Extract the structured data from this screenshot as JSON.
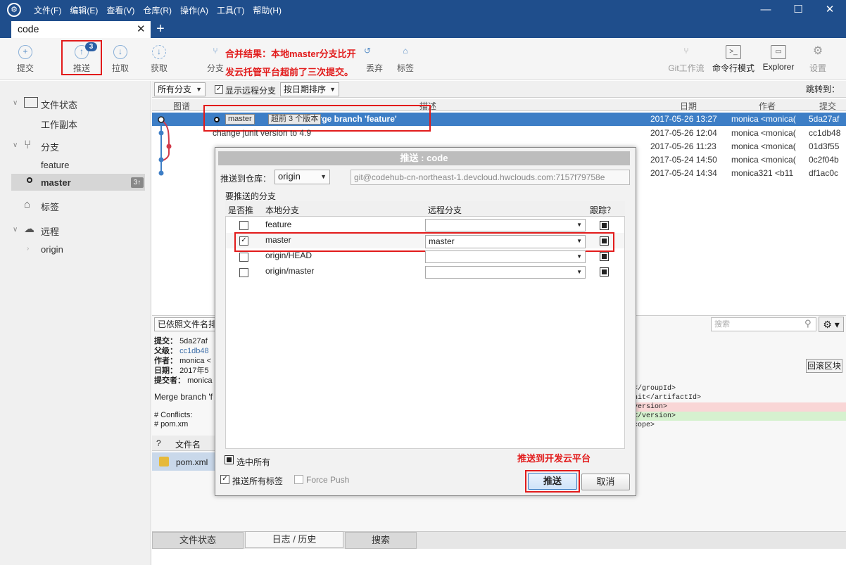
{
  "menu": [
    "文件(F)",
    "编辑(E)",
    "查看(V)",
    "仓库(R)",
    "操作(A)",
    "工具(T)",
    "帮助(H)"
  ],
  "window_controls": {
    "minimize": "—",
    "maximize": "☐",
    "close": "✕"
  },
  "tab": {
    "name": "code",
    "close": "✕",
    "add": "+"
  },
  "toolbar": {
    "commit": "提交",
    "push": "推送",
    "push_badge": "3",
    "pull": "拉取",
    "fetch": "获取",
    "branch": "分支",
    "discard": "丢弃",
    "tag": "标签",
    "git_flow": "Git工作流",
    "terminal": "命令行模式",
    "explorer": "Explorer",
    "settings": "设置"
  },
  "annotations": {
    "toolbar_note_line1": "合并结果：本地master分支比开",
    "toolbar_note_line2": "发云托管平台超前了三次提交。",
    "push_note": "推送到开发云平台"
  },
  "sidebar": {
    "file_status": "文件状态",
    "working_copy": "工作副本",
    "branches": "分支",
    "branch_feature": "feature",
    "branch_master": "master",
    "master_count": "3↑",
    "tags": "标签",
    "remotes": "远程",
    "remote_origin": "origin"
  },
  "filter": {
    "branch_filter": "所有分支",
    "show_remote": "显示远程分支",
    "sort": "按日期排序",
    "jump_to": "跳转到："
  },
  "columns": {
    "graph": "图谱",
    "description": "描述",
    "date": "日期",
    "author": "作者",
    "commit": "提交"
  },
  "history": [
    {
      "description": "Merge branch 'feature'",
      "branch_tag": "master",
      "ahead_tag": "超前 3 个版本",
      "date": "2017-05-26 13:27",
      "author": "monica <monica(",
      "hash": "5da27af"
    },
    {
      "description": "change junit version to 4.9",
      "date": "2017-05-26 12:04",
      "author": "monica <monica(",
      "hash": "cc1db48"
    },
    {
      "description": "",
      "date": "2017-05-26 11:23",
      "author": "monica <monica(",
      "hash": "01d3f55"
    },
    {
      "description": "",
      "date": "2017-05-24 14:50",
      "author": "monica <monica(",
      "hash": "0c2f04b"
    },
    {
      "description": "",
      "date": "2017-05-24 14:34",
      "author": "monica321 <b11",
      "hash": "df1ac0c"
    }
  ],
  "detail": {
    "sort_label": "已依照文件名排",
    "commit_label": "提交：",
    "commit_value": "5da27af",
    "parents_label": "父级：",
    "parents_value": "cc1db48",
    "author_label": "作者：",
    "author_value": "monica <",
    "date_label": "日期：",
    "date_value": "2017年5",
    "committer_label": "提交者：",
    "committer_value": "monica",
    "message": "Merge branch 'f",
    "conflicts_title": "# Conflicts:",
    "conflicts_file": "#        pom.xm",
    "files_q": "?",
    "files_header": "文件名",
    "file_name": "pom.xml",
    "search_placeholder": "搜索",
    "reset_hunk": "回滚区块",
    "diff_lines": [
      "</groupId>",
      "nit</artifactId>",
      "version>",
      "</version>",
      "cope>"
    ]
  },
  "bottom_tabs": [
    "文件状态",
    "日志 / 历史",
    "搜索"
  ],
  "modal": {
    "title": "推送 : code",
    "push_to_repo_label": "推送到仓库：",
    "repo": "origin",
    "repo_url": "git@codehub-cn-northeast-1.devcloud.hwclouds.com:7157f79758e",
    "branches_group": "要推送的分支",
    "col_push": "是否推",
    "col_local": "本地分支",
    "col_remote": "远程分支",
    "col_track": "跟踪？",
    "rows": [
      {
        "local": "feature",
        "remote": "",
        "checked": false
      },
      {
        "local": "master",
        "remote": "master",
        "checked": true
      },
      {
        "local": "origin/HEAD",
        "remote": "",
        "checked": false
      },
      {
        "local": "origin/master",
        "remote": "",
        "checked": false
      }
    ],
    "select_all": "选中所有",
    "push_all_tags": "推送所有标签",
    "force_push": "Force Push",
    "push_button": "推送",
    "cancel_button": "取消"
  }
}
